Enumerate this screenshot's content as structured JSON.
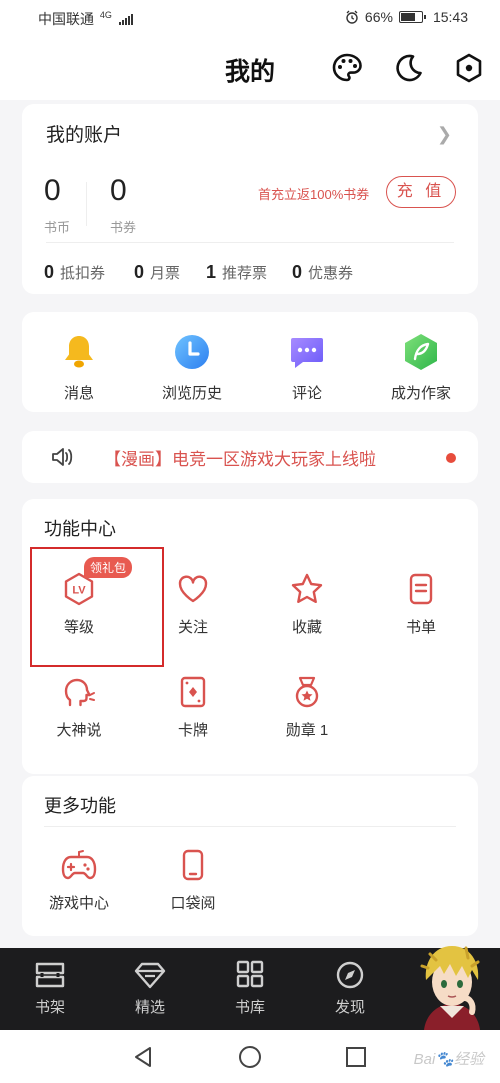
{
  "status_bar": {
    "carrier": "中国联通",
    "network": "4G",
    "battery": "66%",
    "time": "15:43"
  },
  "header": {
    "title": "我的",
    "icons": [
      "palette-icon",
      "moon-icon",
      "settings-hexagon-icon"
    ]
  },
  "account": {
    "title": "我的账户",
    "coins_value": "0",
    "coins_label": "书币",
    "vouchers_value": "0",
    "vouchers_label": "书券",
    "promo": "首充立返100%书券",
    "recharge_label": "充 值",
    "coupons": [
      {
        "value": "0",
        "label": "抵扣券"
      },
      {
        "value": "0",
        "label": "月票"
      },
      {
        "value": "1",
        "label": "推荐票"
      },
      {
        "value": "0",
        "label": "优惠券"
      }
    ]
  },
  "quick_actions": [
    {
      "label": "消息",
      "icon": "bell-icon"
    },
    {
      "label": "浏览历史",
      "icon": "clock-icon"
    },
    {
      "label": "评论",
      "icon": "comment-icon"
    },
    {
      "label": "成为作家",
      "icon": "feather-icon"
    }
  ],
  "notice": {
    "text": "【漫画】电竞一区游戏大玩家上线啦"
  },
  "function_center": {
    "title": "功能中心",
    "badge": "领礼包",
    "items": [
      {
        "label": "等级",
        "icon": "level-icon"
      },
      {
        "label": "关注",
        "icon": "heart-icon"
      },
      {
        "label": "收藏",
        "icon": "star-icon"
      },
      {
        "label": "书单",
        "icon": "booklist-icon"
      },
      {
        "label": "大神说",
        "icon": "speaking-head-icon"
      },
      {
        "label": "卡牌",
        "icon": "card-icon"
      },
      {
        "label": "勋章 1",
        "icon": "medal-icon"
      }
    ]
  },
  "more_functions": {
    "title": "更多功能",
    "items": [
      {
        "label": "游戏中心",
        "icon": "gamepad-icon"
      },
      {
        "label": "口袋阅",
        "icon": "phone-icon"
      }
    ]
  },
  "tab_bar": {
    "items": [
      {
        "label": "书架",
        "icon": "bookshelf-icon"
      },
      {
        "label": "精选",
        "icon": "diamond-icon"
      },
      {
        "label": "书库",
        "icon": "grid-icon"
      },
      {
        "label": "发现",
        "icon": "compass-icon"
      }
    ]
  },
  "colors": {
    "accent": "#d9534f",
    "tab_bar_bg": "#1c1c1e",
    "page_bg": "#f5f5f7"
  }
}
